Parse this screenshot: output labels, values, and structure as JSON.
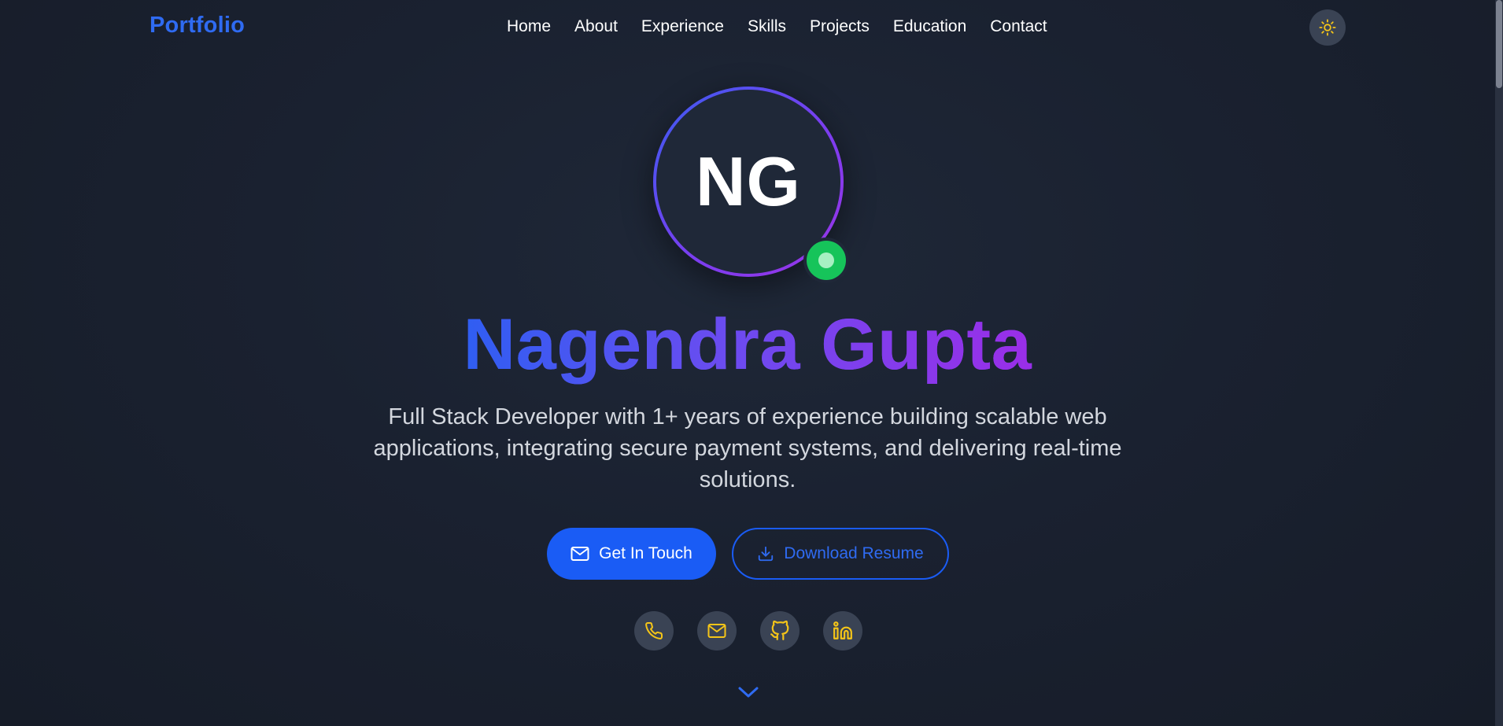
{
  "navbar": {
    "brand": "Portfolio",
    "links": [
      "Home",
      "About",
      "Experience",
      "Skills",
      "Projects",
      "Education",
      "Contact"
    ],
    "theme_toggle_icon": "sun-icon"
  },
  "hero": {
    "initials": "NG",
    "name": "Nagendra Gupta",
    "tagline": "Full Stack Developer with 1+ years of experience building scalable web applications, integrating secure payment systems, and delivering real-time solutions.",
    "primary_button": {
      "label": "Get In Touch",
      "icon": "mail-icon"
    },
    "secondary_button": {
      "label": "Download Resume",
      "icon": "download-icon"
    },
    "social_icons": [
      "phone-icon",
      "mail-icon",
      "github-icon",
      "linkedin-icon"
    ],
    "scroll_icon": "chevron-down-icon"
  },
  "colors": {
    "background": "#1a2130",
    "brand_blue": "#2f6bf2",
    "primary_button": "#1a5cf5",
    "icon_yellow": "#f5c518",
    "status_green": "#16c45a",
    "gradient_start": "#2f5ef2",
    "gradient_end": "#9a2ee8"
  }
}
